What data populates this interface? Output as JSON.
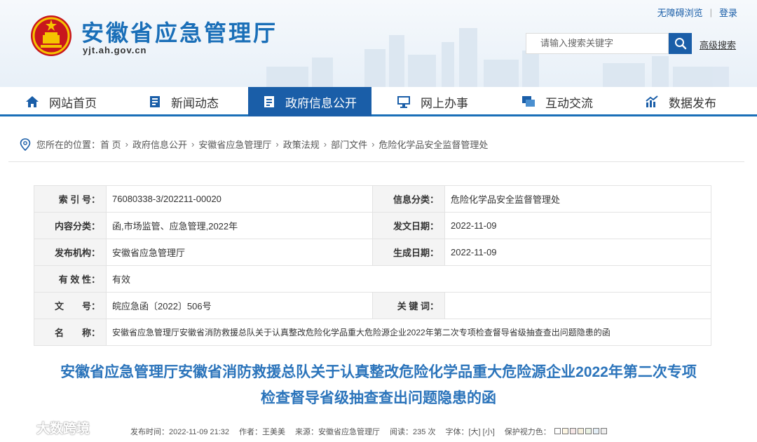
{
  "header": {
    "site_title": "安徽省应急管理厅",
    "site_domain": "yjt.ah.gov.cn",
    "accessibility_link": "无障碍浏览",
    "login_link": "登录",
    "search_placeholder": "请输入搜索关键字",
    "advanced_search": "高级搜索"
  },
  "nav": {
    "items": [
      {
        "label": "网站首页",
        "icon": "home-icon"
      },
      {
        "label": "新闻动态",
        "icon": "news-icon"
      },
      {
        "label": "政府信息公开",
        "icon": "document-icon"
      },
      {
        "label": "网上办事",
        "icon": "monitor-icon"
      },
      {
        "label": "互动交流",
        "icon": "chat-icon"
      },
      {
        "label": "数据发布",
        "icon": "chart-icon"
      }
    ],
    "active_index": 2
  },
  "breadcrumb": {
    "prefix": "您所在的位置：",
    "items": [
      "首 页",
      "政府信息公开",
      "安徽省应急管理厅",
      "政策法规",
      "部门文件",
      "危险化学品安全监督管理处"
    ]
  },
  "info": {
    "index_label": "索 引 号：",
    "index_value": "76080338-3/202211-00020",
    "category_label": "信息分类：",
    "category_value": "危险化学品安全监督管理处",
    "content_label": "内容分类：",
    "content_value": "函,市场监管、应急管理,2022年",
    "issue_date_label": "发文日期：",
    "issue_date_value": "2022-11-09",
    "publisher_label": "发布机构：",
    "publisher_value": "安徽省应急管理厅",
    "effective_date_label": "生成日期：",
    "effective_date_value": "2022-11-09",
    "validity_label": "有 效 性：",
    "validity_value": "有效",
    "doc_no_label": "文　　号：",
    "doc_no_value": "皖应急函〔2022〕506号",
    "keywords_label": "关 键 词：",
    "keywords_value": "",
    "name_label": "名　　称：",
    "name_value": "安徽省应急管理厅安徽省消防救援总队关于认真整改危险化学品重大危险源企业2022年第二次专项检查督导省级抽查查出问题隐患的函"
  },
  "article": {
    "title_line1": "安徽省应急管理厅安徽省消防救援总队关于认真整改危险化学品重大危险源企业2022年第二次专项",
    "title_line2": "检查督导省级抽查查出问题隐患的函",
    "publish_time": "发布时间：2022-11-09 21:32",
    "author": "作者：王美美",
    "source": "来源：安徽省应急管理厅",
    "reads": "阅读：235 次",
    "font_size": "字体：[大] [小]",
    "eye_protection": "保护视力色："
  },
  "watermark": "大数跨境",
  "colors": {
    "brand_blue": "#1a5ea8",
    "title_blue": "#2b74bb"
  }
}
